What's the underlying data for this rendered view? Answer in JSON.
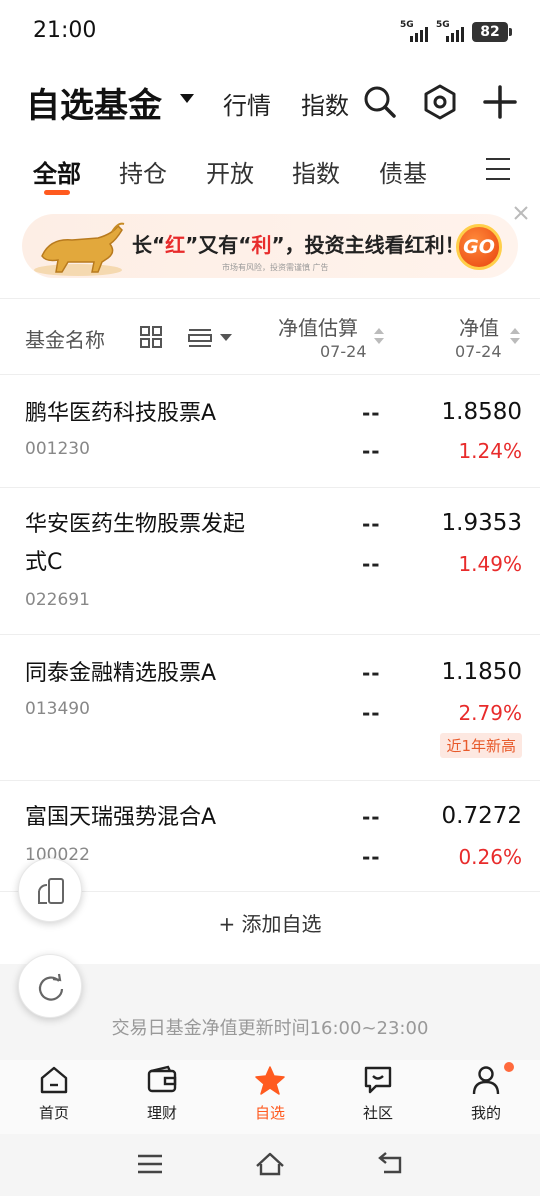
{
  "status_bar": {
    "time": "21:00",
    "signal1_label": "5G",
    "signal2_label": "5G",
    "battery": "82"
  },
  "header": {
    "title": "自选基金",
    "market_link": "行情",
    "index_link": "指数"
  },
  "tabs": [
    {
      "label": "全部",
      "active": true
    },
    {
      "label": "持仓"
    },
    {
      "label": "开放"
    },
    {
      "label": "指数"
    },
    {
      "label": "债基"
    }
  ],
  "banner": {
    "text_pre": "长“",
    "text_hl1": "红",
    "text_mid1": "”又有“",
    "text_hl2": "利",
    "text_post": "”，投资主线看红利！",
    "sub": "市场有风险，投资需谨慎 广告",
    "go_label": "GO"
  },
  "columns": {
    "name": "基金名称",
    "estimate": "净值估算",
    "estimate_date": "07-24",
    "nav": "净值",
    "nav_date": "07-24"
  },
  "funds": [
    {
      "name": "鹏华医药科技股票A",
      "code": "001230",
      "est": "--",
      "est_chg": "--",
      "nav": "1.8580",
      "chg": "1.24%"
    },
    {
      "name": "华安医药生物股票发起式C",
      "code": "022691",
      "est": "--",
      "est_chg": "--",
      "nav": "1.9353",
      "chg": "1.49%"
    },
    {
      "name": "同泰金融精选股票A",
      "code": "013490",
      "est": "--",
      "est_chg": "--",
      "nav": "1.1850",
      "chg": "2.79%",
      "badge": "近1年新高"
    },
    {
      "name": "富国天瑞强势混合A",
      "code": "100022",
      "est": "--",
      "est_chg": "--",
      "nav": "0.7272",
      "chg": "0.26%"
    }
  ],
  "add_label": "+ 添加自选",
  "update_note": "交易日基金净值更新时间16:00~23:00",
  "bottom_nav": [
    {
      "label": "首页",
      "icon": "home-icon"
    },
    {
      "label": "理财",
      "icon": "wallet-icon"
    },
    {
      "label": "自选",
      "icon": "star-icon",
      "active": true
    },
    {
      "label": "社区",
      "icon": "chat-icon"
    },
    {
      "label": "我的",
      "icon": "user-icon"
    }
  ],
  "colors": {
    "accent": "#ff5a1f",
    "up_red": "#e82b2b"
  }
}
